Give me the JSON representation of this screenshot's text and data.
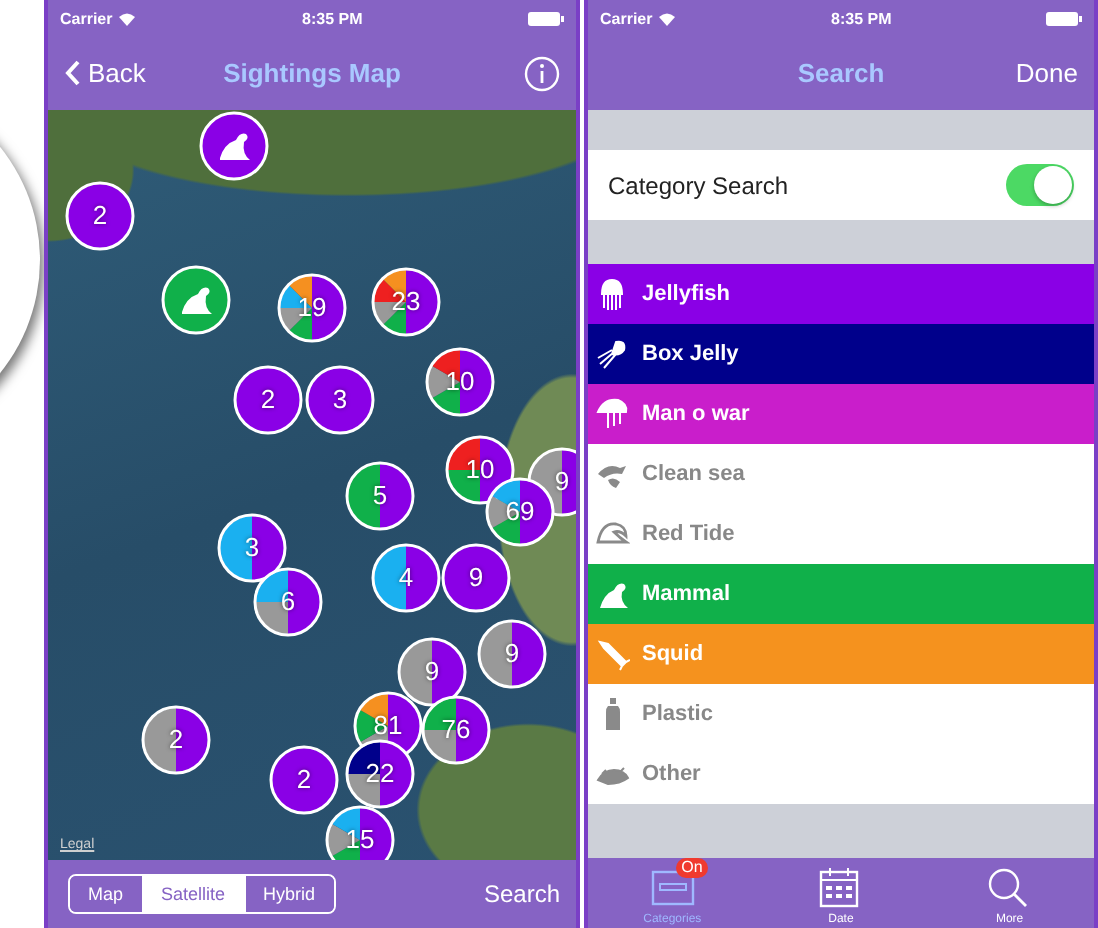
{
  "map_screen": {
    "status_bar": {
      "carrier": "Carrier",
      "time": "8:35 PM"
    },
    "nav": {
      "back": "Back",
      "title": "Sightings Map"
    },
    "map": {
      "legal": "Legal",
      "clusters": [
        {
          "kind": "icon",
          "slices": [
            {
              "color": "#8a00e6"
            }
          ]
        },
        {
          "kind": "count",
          "label": "2",
          "slices": [
            {
              "color": "#8a00e6"
            }
          ]
        },
        {
          "kind": "icon",
          "slices": [
            {
              "color": "#10b04a"
            }
          ]
        },
        {
          "kind": "count",
          "label": "19",
          "slices": [
            {
              "color": "#8a00e6"
            },
            {
              "color": "#10b04a"
            },
            {
              "color": "#999999"
            },
            {
              "color": "#1ab0f0"
            },
            {
              "color": "#f59020"
            }
          ]
        },
        {
          "kind": "count",
          "label": "23",
          "slices": [
            {
              "color": "#8a00e6"
            },
            {
              "color": "#10b04a"
            },
            {
              "color": "#999999"
            },
            {
              "color": "#ee2020"
            },
            {
              "color": "#f59020"
            }
          ]
        },
        {
          "kind": "count",
          "label": "10",
          "slices": [
            {
              "color": "#8a00e6"
            },
            {
              "color": "#10b04a"
            },
            {
              "color": "#999999"
            },
            {
              "color": "#ee2020"
            }
          ]
        },
        {
          "kind": "count",
          "label": "2",
          "slices": [
            {
              "color": "#8a00e6"
            }
          ]
        },
        {
          "kind": "count",
          "label": "3",
          "slices": [
            {
              "color": "#8a00e6"
            }
          ]
        },
        {
          "kind": "count",
          "label": "10",
          "slices": [
            {
              "color": "#8a00e6"
            },
            {
              "color": "#10b04a"
            },
            {
              "color": "#ee2020"
            }
          ]
        },
        {
          "kind": "count",
          "label": "9",
          "slices": [
            {
              "color": "#8a00e6"
            },
            {
              "color": "#999999"
            }
          ]
        },
        {
          "kind": "count",
          "label": "5",
          "slices": [
            {
              "color": "#8a00e6"
            },
            {
              "color": "#10b04a"
            }
          ]
        },
        {
          "kind": "count",
          "label": "69",
          "slices": [
            {
              "color": "#8a00e6"
            },
            {
              "color": "#10b04a"
            },
            {
              "color": "#999999"
            },
            {
              "color": "#1ab0f0"
            }
          ]
        },
        {
          "kind": "count",
          "label": "3",
          "slices": [
            {
              "color": "#8a00e6"
            },
            {
              "color": "#1ab0f0"
            }
          ]
        },
        {
          "kind": "count",
          "label": "6",
          "slices": [
            {
              "color": "#8a00e6"
            },
            {
              "color": "#999999"
            },
            {
              "color": "#1ab0f0"
            }
          ]
        },
        {
          "kind": "count",
          "label": "4",
          "slices": [
            {
              "color": "#8a00e6"
            },
            {
              "color": "#1ab0f0"
            }
          ]
        },
        {
          "kind": "count",
          "label": "9",
          "slices": [
            {
              "color": "#8a00e6"
            }
          ]
        },
        {
          "kind": "count",
          "label": "9",
          "slices": [
            {
              "color": "#8a00e6"
            },
            {
              "color": "#999999"
            }
          ]
        },
        {
          "kind": "count",
          "label": "9",
          "slices": [
            {
              "color": "#8a00e6"
            },
            {
              "color": "#999999"
            }
          ]
        },
        {
          "kind": "count",
          "label": "2",
          "slices": [
            {
              "color": "#8a00e6"
            },
            {
              "color": "#999999"
            }
          ]
        },
        {
          "kind": "count",
          "label": "81",
          "slices": [
            {
              "color": "#8a00e6"
            },
            {
              "color": "#999999"
            },
            {
              "color": "#10b04a"
            },
            {
              "color": "#f59020"
            }
          ]
        },
        {
          "kind": "count",
          "label": "76",
          "slices": [
            {
              "color": "#8a00e6"
            },
            {
              "color": "#999999"
            },
            {
              "color": "#10b04a"
            }
          ]
        },
        {
          "kind": "count",
          "label": "2",
          "slices": [
            {
              "color": "#8a00e6"
            }
          ]
        },
        {
          "kind": "count",
          "label": "22",
          "slices": [
            {
              "color": "#8a00e6"
            },
            {
              "color": "#999999"
            },
            {
              "color": "#00008b"
            }
          ]
        },
        {
          "kind": "count",
          "label": "15",
          "slices": [
            {
              "color": "#8a00e6"
            },
            {
              "color": "#10b04a"
            },
            {
              "color": "#999999"
            },
            {
              "color": "#1ab0f0"
            }
          ]
        }
      ]
    },
    "segments": [
      {
        "label": "Map",
        "selected": false
      },
      {
        "label": "Satellite",
        "selected": true
      },
      {
        "label": "Hybrid",
        "selected": false
      }
    ],
    "search": "Search"
  },
  "search_screen": {
    "status_bar": {
      "carrier": "Carrier",
      "time": "8:35 PM"
    },
    "nav": {
      "title": "Search",
      "done": "Done"
    },
    "category_search": {
      "label": "Category Search",
      "on": true
    },
    "categories": [
      {
        "label": "Jellyfish",
        "selected": true,
        "color": "#8a00e6"
      },
      {
        "label": "Box Jelly",
        "selected": true,
        "color": "#00008b"
      },
      {
        "label": "Man o war",
        "selected": true,
        "color": "#c91ecb"
      },
      {
        "label": "Clean sea",
        "selected": false
      },
      {
        "label": "Red Tide",
        "selected": false
      },
      {
        "label": "Mammal",
        "selected": true,
        "color": "#10b04a"
      },
      {
        "label": "Squid",
        "selected": true,
        "color": "#f5921e"
      },
      {
        "label": "Plastic",
        "selected": false
      },
      {
        "label": "Other",
        "selected": false
      }
    ],
    "tabs": [
      {
        "label": "Categories",
        "selected": true,
        "badge": "On"
      },
      {
        "label": "Date",
        "selected": false
      },
      {
        "label": "More",
        "selected": false
      }
    ]
  }
}
